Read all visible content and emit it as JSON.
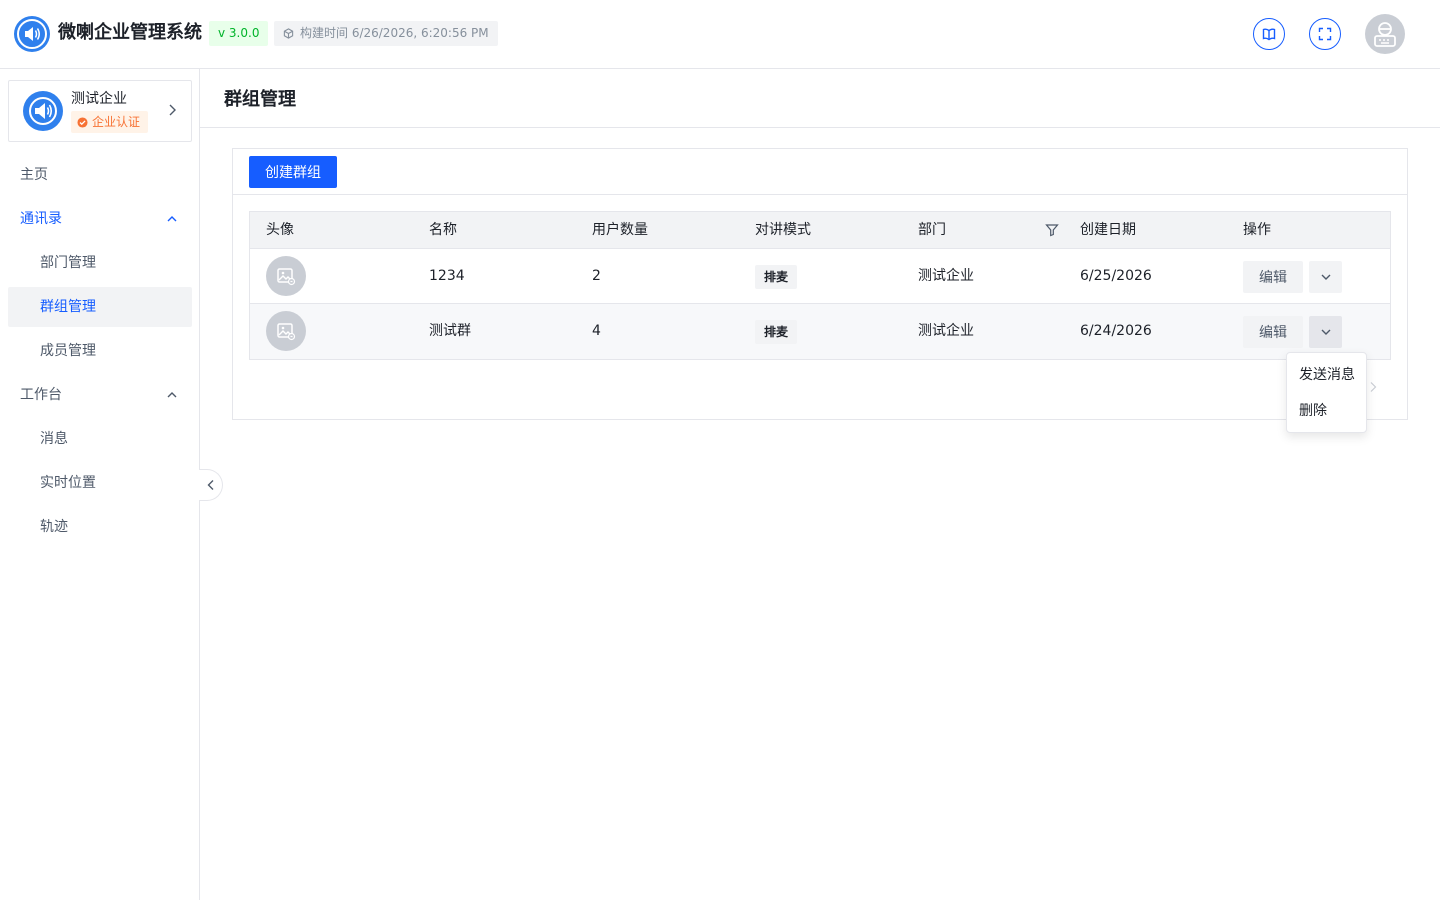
{
  "header": {
    "app_title": "微喇企业管理系统",
    "version": "v 3.0.0",
    "build_time": "构建时间 6/26/2026, 6:20:56 PM",
    "accent": "#165dff"
  },
  "enterprise": {
    "name": "测试企业",
    "badge": "企业认证"
  },
  "sidebar": {
    "items": [
      {
        "label": "主页"
      },
      {
        "label": "通讯录"
      },
      {
        "label": "部门管理"
      },
      {
        "label": "群组管理"
      },
      {
        "label": "成员管理"
      },
      {
        "label": "工作台"
      },
      {
        "label": "消息"
      },
      {
        "label": "实时位置"
      },
      {
        "label": "轨迹"
      }
    ]
  },
  "page": {
    "title": "群组管理",
    "create_button": "创建群组"
  },
  "table": {
    "columns": [
      "头像",
      "名称",
      "用户数量",
      "对讲模式",
      "部门",
      "创建日期",
      "操作"
    ],
    "rows": [
      {
        "name": "1234",
        "user_count": "2",
        "mode": "排麦",
        "department": "测试企业",
        "created": "6/25/2026",
        "edit": "编辑"
      },
      {
        "name": "测试群",
        "user_count": "4",
        "mode": "排麦",
        "department": "测试企业",
        "created": "6/24/2026",
        "edit": "编辑"
      }
    ]
  },
  "dropdown": {
    "items": [
      "发送消息",
      "删除"
    ]
  }
}
